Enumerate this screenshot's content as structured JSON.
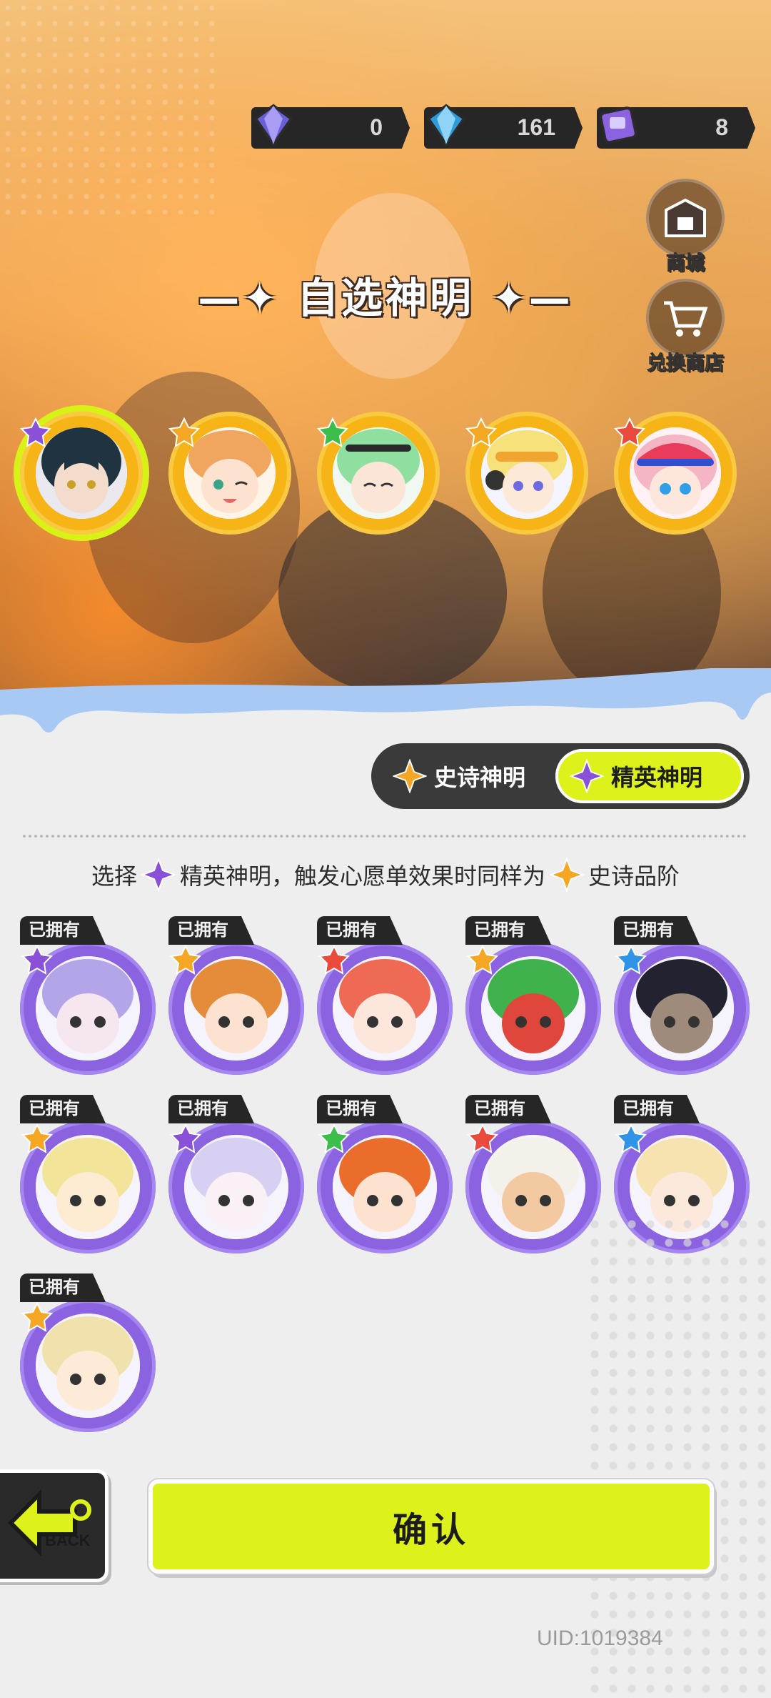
{
  "currencies": [
    {
      "name": "purple-gem",
      "value": "0"
    },
    {
      "name": "blue-gem",
      "value": "161"
    },
    {
      "name": "ticket",
      "value": "8"
    }
  ],
  "side_buttons": {
    "shop": "商城",
    "exchange_shop": "兑换商店"
  },
  "title": "自选神明",
  "featured": [
    {
      "id": "god-1",
      "star": "purple",
      "hair": "#1f3340",
      "skin": "#f3dccc",
      "selected": true
    },
    {
      "id": "god-2",
      "star": "orange",
      "hair": "#f1a660",
      "skin": "#fde3cf",
      "selected": false
    },
    {
      "id": "god-3",
      "star": "green",
      "hair": "#8fe0a0",
      "skin": "#fbe5d6",
      "selected": false
    },
    {
      "id": "god-4",
      "star": "orange",
      "hair": "#f7e17a",
      "skin": "#fde9d8",
      "selected": false
    },
    {
      "id": "god-5",
      "star": "red",
      "hair": "#f4b6c4",
      "skin": "#fde6dc",
      "selected": false
    }
  ],
  "tabs": {
    "epic": "史诗神明",
    "elite": "精英神明",
    "active": "elite"
  },
  "hint": {
    "part1": "选择",
    "part2": "精英神明，触发心愿单效果时同样为",
    "part3": "史诗品阶"
  },
  "owned_label": "已拥有",
  "owned": [
    {
      "star": "purple",
      "hair": "#b3a5e8",
      "skin": "#f5e6f0"
    },
    {
      "star": "orange",
      "hair": "#e58c3a",
      "skin": "#fde3cf"
    },
    {
      "star": "red",
      "hair": "#ef6a55",
      "skin": "#fde6dc"
    },
    {
      "star": "orange",
      "hair": "#3fb14d",
      "skin": "#e0473c"
    },
    {
      "star": "blue",
      "hair": "#222230",
      "skin": "#9f8b7c"
    },
    {
      "star": "orange",
      "hair": "#f2e59a",
      "skin": "#fdebd2"
    },
    {
      "star": "purple",
      "hair": "#d7d0f2",
      "skin": "#faf1f7"
    },
    {
      "star": "green",
      "hair": "#ea6d2b",
      "skin": "#fde3cf"
    },
    {
      "star": "red",
      "hair": "#f4f1ea",
      "skin": "#f2c9a0"
    },
    {
      "star": "blue",
      "hair": "#f6e3b0",
      "skin": "#fde8dc"
    },
    {
      "star": "orange",
      "hair": "#f1e1ad",
      "skin": "#fdebd8"
    }
  ],
  "back_label": "BACK",
  "confirm_label": "确认",
  "uid": "UID:1019384",
  "colors": {
    "accent": "#dcf21a",
    "elite_purple": "#8b63e0",
    "epic_orange": "#f6b417",
    "dark": "#262626"
  }
}
